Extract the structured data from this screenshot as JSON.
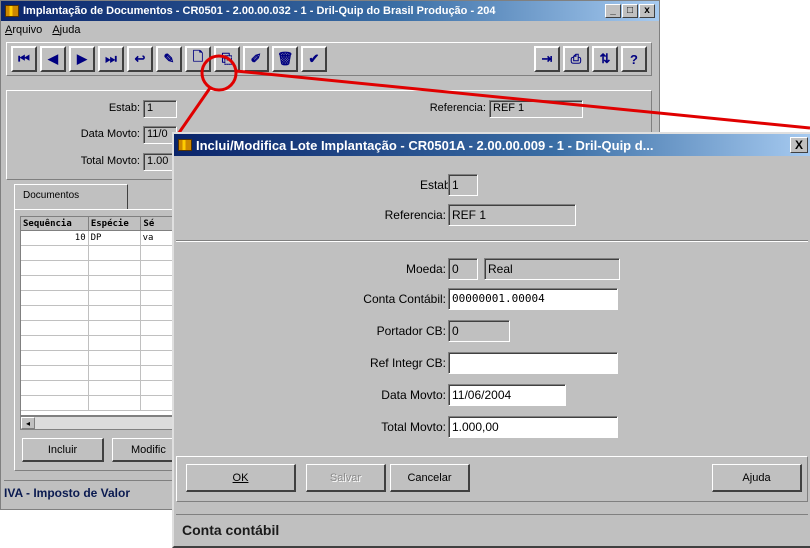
{
  "main_window": {
    "title": "Implantação de Documentos - CR0501 - 2.00.00.032 - 1 - Dril-Quip do Brasil Produção - 204",
    "controls": {
      "minimize": "_",
      "maximize": "□",
      "close": "x"
    },
    "menu": [
      "Arquivo",
      "Ajuda"
    ],
    "toolbar_left": [
      {
        "icon": "first-record-icon",
        "glyph": "⏮"
      },
      {
        "icon": "previous-record-icon",
        "glyph": "◀"
      },
      {
        "icon": "next-record-icon",
        "glyph": "▶"
      },
      {
        "icon": "last-record-icon",
        "glyph": "⏭"
      },
      {
        "icon": "goto-icon",
        "glyph": "↩"
      },
      {
        "icon": "search-icon",
        "glyph": "✎"
      },
      {
        "icon": "new-document-icon",
        "glyph": "🗋"
      },
      {
        "icon": "copy-icon",
        "glyph": "⎘"
      },
      {
        "icon": "edit-icon",
        "glyph": "✐"
      },
      {
        "icon": "delete-icon",
        "glyph": "🗑"
      },
      {
        "icon": "check-icon",
        "glyph": "✔"
      }
    ],
    "toolbar_right": [
      {
        "icon": "exit-icon",
        "glyph": "⇥"
      },
      {
        "icon": "print-icon",
        "glyph": "⎙"
      },
      {
        "icon": "query-icon",
        "glyph": "⇅"
      },
      {
        "icon": "help-icon",
        "glyph": "?"
      }
    ],
    "fields": {
      "estab_label": "Estab:",
      "estab_value": "1",
      "data_movto_label": "Data Movto:",
      "data_movto_value": "11/0",
      "total_movto_label": "Total Movto:",
      "total_movto_value": "1.00",
      "referencia_label": "Referencia:",
      "referencia_value": "REF 1"
    },
    "tab_label": "Documentos",
    "grid": {
      "columns": [
        "Sequência",
        "Espécie",
        "Sé"
      ],
      "rows": [
        [
          "10",
          "DP",
          "va"
        ]
      ]
    },
    "buttons": {
      "incluir": "Incluir",
      "modificar": "Modific"
    },
    "status_text": "IVA - Imposto de Valor"
  },
  "dialog": {
    "title": "Inclui/Modifica Lote Implantação - CR0501A - 2.00.00.009 - 1 - Dril-Quip d...",
    "close_glyph": "X",
    "estab_label": "Estab:",
    "estab_value": "1",
    "referencia_label": "Referencia:",
    "referencia_value": "REF 1",
    "moeda_label": "Moeda:",
    "moeda_code": "0",
    "moeda_name": "Real",
    "conta_label": "Conta Contábil:",
    "conta_value": "00000001.00004",
    "portador_label": "Portador CB:",
    "portador_value": "0",
    "ref_integr_label": "Ref Integr CB:",
    "ref_integr_value": "",
    "data_movto_label": "Data Movto:",
    "data_movto_value": "11/06/2004",
    "total_movto_label": "Total Movto:",
    "total_movto_value": "1.000,00",
    "buttons": {
      "ok": "OK",
      "salvar": "Salvar",
      "cancelar": "Cancelar",
      "ajuda": "Ajuda"
    },
    "status_text": "Conta contábil"
  },
  "colors": {
    "title_active": "#0a246a",
    "face": "#c0c0c0",
    "annotation": "#e00000"
  }
}
